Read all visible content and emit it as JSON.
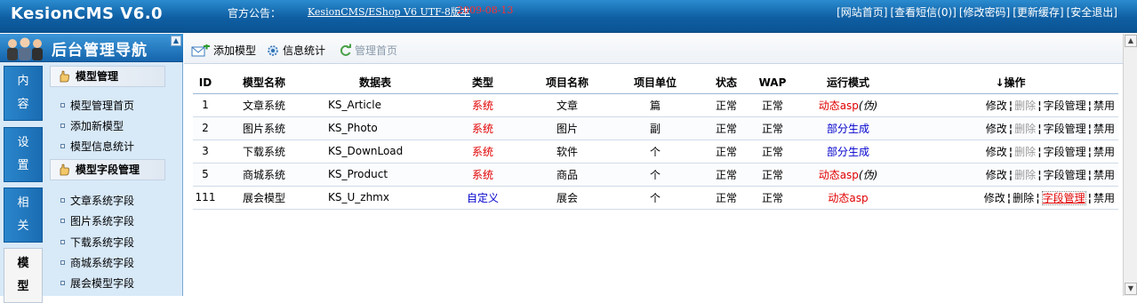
{
  "header": {
    "brand": "KesionCMS V6.0",
    "notice_label": "官方公告：",
    "notice_text": "KesionCMS/EShop V6 UTF-8版本",
    "notice_date": "2009-08-13",
    "links": [
      "[网站首页]",
      "[查看短信(0)]",
      "[修改密码]",
      "[更新缓存]",
      "[安全退出]"
    ]
  },
  "sidebar": {
    "title": "后台管理导航",
    "vtabs": [
      {
        "label_1": "内",
        "label_2": "容"
      },
      {
        "label_1": "设",
        "label_2": "置"
      },
      {
        "label_1": "相",
        "label_2": "关"
      },
      {
        "label_1": "模",
        "label_2": "型"
      }
    ],
    "groups": [
      {
        "title": "模型管理",
        "items": [
          "模型管理首页",
          "添加新模型",
          "模型信息统计"
        ]
      },
      {
        "title": "模型字段管理",
        "items": [
          "文章系统字段",
          "图片系统字段",
          "下载系统字段",
          "商城系统字段",
          "展会模型字段"
        ]
      }
    ]
  },
  "toolbar": {
    "add_model": "添加模型",
    "info_stats": "信息统计",
    "manage_home": "管理首页"
  },
  "table": {
    "headers": [
      "ID",
      "模型名称",
      "数据表",
      "类型",
      "项目名称",
      "项目单位",
      "状态",
      "WAP",
      "运行模式",
      "↓操作"
    ],
    "rows": [
      {
        "id": "1",
        "name": "文章系统",
        "table": "KS_Article",
        "type": "系统",
        "item": "文章",
        "unit": "篇",
        "status": "正常",
        "wap": "正常",
        "mode": "动态asp",
        "mode_suffix": "(伪)"
      },
      {
        "id": "2",
        "name": "图片系统",
        "table": "KS_Photo",
        "type": "系统",
        "item": "图片",
        "unit": "副",
        "status": "正常",
        "wap": "正常",
        "mode": "部分生成",
        "mode_suffix": ""
      },
      {
        "id": "3",
        "name": "下载系统",
        "table": "KS_DownLoad",
        "type": "系统",
        "item": "软件",
        "unit": "个",
        "status": "正常",
        "wap": "正常",
        "mode": "部分生成",
        "mode_suffix": ""
      },
      {
        "id": "5",
        "name": "商城系统",
        "table": "KS_Product",
        "type": "系统",
        "item": "商品",
        "unit": "个",
        "status": "正常",
        "wap": "正常",
        "mode": "动态asp",
        "mode_suffix": "(伪)"
      },
      {
        "id": "111",
        "name": "展会模型",
        "table": "KS_U_zhmx",
        "type": "自定义",
        "item": "展会",
        "unit": "个",
        "status": "正常",
        "wap": "正常",
        "mode": "动态asp",
        "mode_suffix": ""
      }
    ],
    "ops": {
      "edit": "修改",
      "delete": "删除",
      "fields": "字段管理",
      "disable": "禁用"
    }
  },
  "colors": {
    "header_blue": "#0f5fa3",
    "red": "#e00000",
    "blue": "#0000cc"
  }
}
